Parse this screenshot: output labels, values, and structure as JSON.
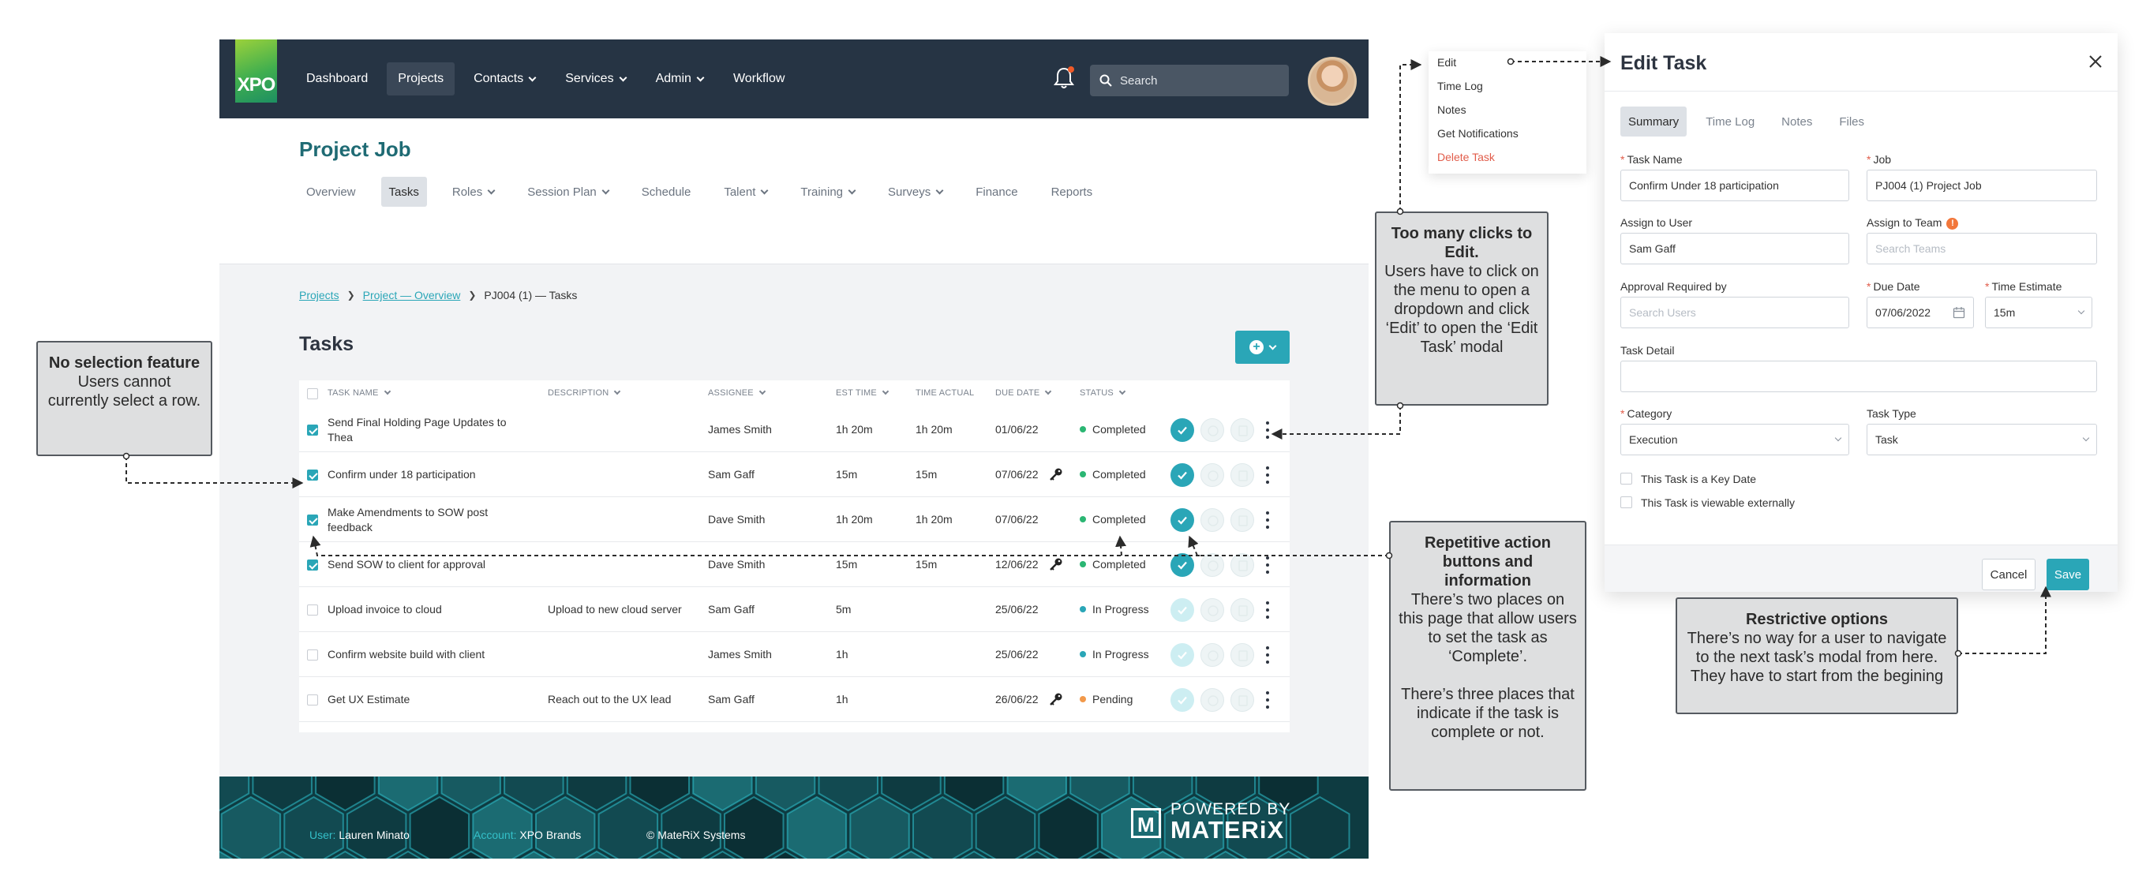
{
  "app": {
    "logo_text": "XPO",
    "nav": [
      {
        "label": "Dashboard",
        "dropdown": false,
        "active": false
      },
      {
        "label": "Projects",
        "dropdown": false,
        "active": true
      },
      {
        "label": "Contacts",
        "dropdown": true,
        "active": false
      },
      {
        "label": "Services",
        "dropdown": true,
        "active": false
      },
      {
        "label": "Admin",
        "dropdown": true,
        "active": false
      },
      {
        "label": "Workflow",
        "dropdown": false,
        "active": false
      }
    ],
    "search_placeholder": "Search",
    "page_title": "Project Job",
    "subnav": [
      {
        "label": "Overview",
        "dropdown": false,
        "active": false
      },
      {
        "label": "Tasks",
        "dropdown": false,
        "active": true
      },
      {
        "label": "Roles",
        "dropdown": true,
        "active": false
      },
      {
        "label": "Session Plan",
        "dropdown": true,
        "active": false
      },
      {
        "label": "Schedule",
        "dropdown": false,
        "active": false
      },
      {
        "label": "Talent",
        "dropdown": true,
        "active": false
      },
      {
        "label": "Training",
        "dropdown": true,
        "active": false
      },
      {
        "label": "Surveys",
        "dropdown": true,
        "active": false
      },
      {
        "label": "Finance",
        "dropdown": false,
        "active": false
      },
      {
        "label": "Reports",
        "dropdown": false,
        "active": false
      }
    ],
    "breadcrumb": {
      "link1": "Projects",
      "link2": "Project — Overview",
      "current": "PJ004 (1) — Tasks",
      "separator": "❯"
    },
    "tasks_title": "Tasks",
    "table": {
      "headers": [
        "TASK NAME",
        "DESCRIPTION",
        "ASSIGNEE",
        "EST TIME",
        "TIME ACTUAL",
        "DUE DATE",
        "STATUS"
      ],
      "rows": [
        {
          "task": "Send Final Holding Page Updates to Thea",
          "description": "",
          "assignee": "James Smith",
          "est": "1h 20m",
          "actual": "1h 20m",
          "due": "01/06/22",
          "key": false,
          "status": "Completed",
          "checked": true
        },
        {
          "task": "Confirm under 18 participation",
          "description": "",
          "assignee": "Sam Gaff",
          "est": "15m",
          "actual": "15m",
          "due": "07/06/22",
          "key": true,
          "status": "Completed",
          "checked": true
        },
        {
          "task": "Make Amendments to SOW post feedback",
          "description": "",
          "assignee": "Dave Smith",
          "est": "1h 20m",
          "actual": "1h 20m",
          "due": "07/06/22",
          "key": false,
          "status": "Completed",
          "checked": true
        },
        {
          "task": "Send SOW to client for approval",
          "description": "",
          "assignee": "Dave Smith",
          "est": "15m",
          "actual": "15m",
          "due": "12/06/22",
          "key": true,
          "status": "Completed",
          "checked": true
        },
        {
          "task": "Upload invoice to cloud",
          "description": "Upload to new cloud server",
          "assignee": "Sam Gaff",
          "est": "5m",
          "actual": "",
          "due": "25/06/22",
          "key": false,
          "status": "In Progress",
          "checked": false
        },
        {
          "task": "Confirm website build with client",
          "description": "",
          "assignee": "James Smith",
          "est": "1h",
          "actual": "",
          "due": "25/06/22",
          "key": false,
          "status": "In Progress",
          "checked": false
        },
        {
          "task": "Get UX Estimate",
          "description": "Reach out to the UX lead",
          "assignee": "Sam Gaff",
          "est": "1h",
          "actual": "",
          "due": "26/06/22",
          "key": true,
          "status": "Pending",
          "checked": false
        }
      ]
    },
    "footer": {
      "user_label": "User:",
      "user_value": "Lauren Minato",
      "account_label": "Account:",
      "account_value": "XPO Brands",
      "copyright": "© MateRiX Systems",
      "powered_by": "POWERED BY",
      "brand": "MATERiX",
      "brand_mark": "M"
    }
  },
  "context_menu": {
    "items": [
      "Edit",
      "Time Log",
      "Notes",
      "Get Notifications"
    ],
    "danger_item": "Delete Task"
  },
  "modal": {
    "title": "Edit Task",
    "tabs": [
      "Summary",
      "Time Log",
      "Notes",
      "Files"
    ],
    "active_tab": "Summary",
    "required_mark": "*",
    "info_mark": "!",
    "fields": {
      "task_name": {
        "label": "Task Name",
        "value": "Confirm Under 18 participation"
      },
      "job": {
        "label": "Job",
        "value": "PJ004 (1) Project Job"
      },
      "assign_user": {
        "label": "Assign to User",
        "value": "Sam Gaff"
      },
      "assign_team": {
        "label": "Assign to Team",
        "placeholder": "Search Teams"
      },
      "approval": {
        "label": "Approval Required by",
        "placeholder": "Search Users"
      },
      "due_date": {
        "label": "Due Date",
        "value": "07/06/2022"
      },
      "time_estimate": {
        "label": "Time Estimate",
        "value": "15m"
      },
      "task_detail": {
        "label": "Task Detail",
        "value": ""
      },
      "category": {
        "label": "Category",
        "value": "Execution"
      },
      "task_type": {
        "label": "Task Type",
        "value": "Task"
      }
    },
    "checkboxes": [
      "This Task is a Key Date",
      "This Task is viewable externally"
    ],
    "cancel": "Cancel",
    "save": "Save"
  },
  "annotations": {
    "no_selection": {
      "title": "No selection feature",
      "body": "Users cannot currently select a row."
    },
    "too_many_clicks": {
      "title": "Too many clicks to Edit.",
      "body": "Users have to click on the menu to open a dropdown and click ‘Edit’ to open the ‘Edit Task’ modal"
    },
    "repetitive": {
      "title": "Repetitive action buttons and information",
      "body1": "There’s two places on this page that allow users to set the task as ‘Complete’.",
      "body2": "There’s three places that indicate if the task is complete or not."
    },
    "restrictive": {
      "title": "Restrictive options",
      "body": "There’s no way for a user to navigate to the next task’s modal from here. They have to start from the begining"
    }
  },
  "colors": {
    "nav_bg": "#263444",
    "accent": "#2aa6b7",
    "completed": "#2bb673",
    "in_progress": "#2aa6b7",
    "pending": "#f2994a",
    "danger": "#e15c4a"
  }
}
